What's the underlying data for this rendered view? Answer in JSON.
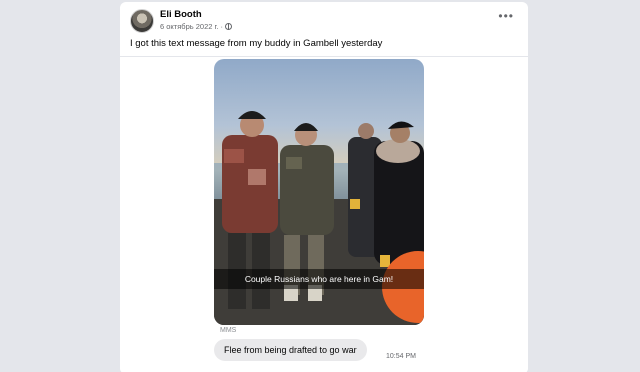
{
  "post": {
    "author": "Eli Booth",
    "date": "6 октябрь 2022 г. ·",
    "text": "I got this text message from my buddy in Gambell yesterday"
  },
  "icons": {
    "more": "ellipsis-icon",
    "privacy": "globe-icon"
  },
  "message": {
    "photo_caption": "Couple Russians who are here in Gam!",
    "type_label": "MMS",
    "sms_text": "Flee from being drafted to go war",
    "time": "10:54 PM"
  },
  "colors": {
    "background": "#e4e6eb",
    "card": "#ffffff",
    "bubble": "#e9e9eb",
    "secondary_text": "#65676b"
  }
}
